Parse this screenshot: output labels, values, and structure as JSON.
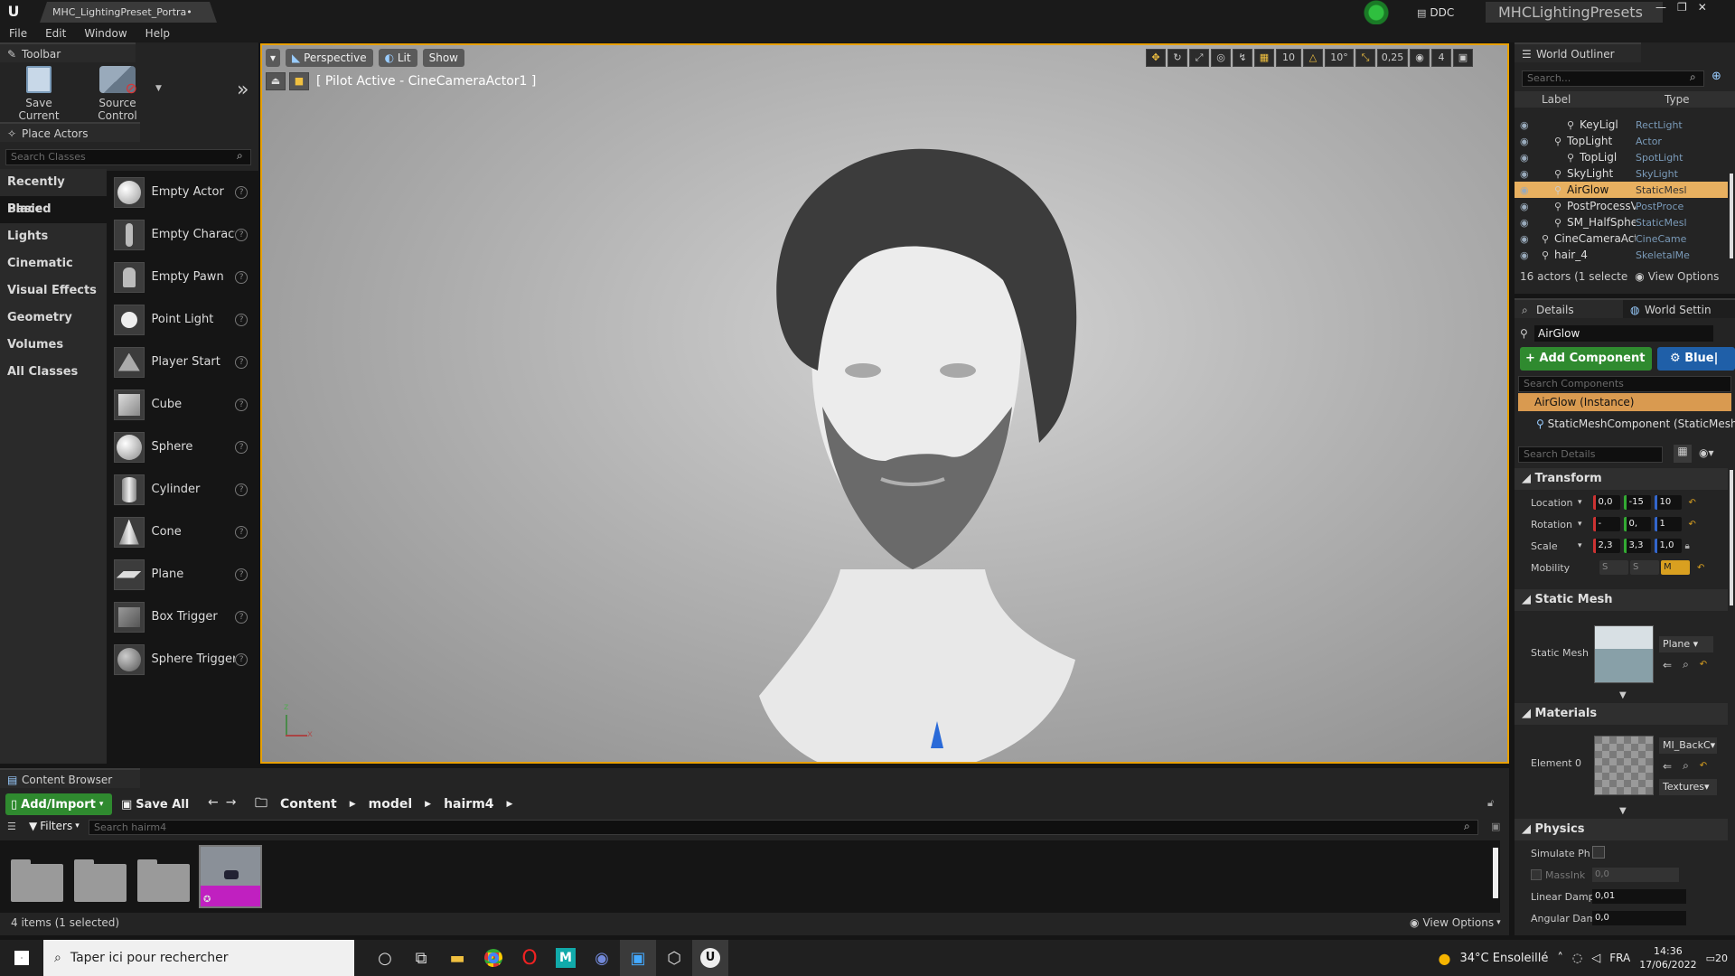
{
  "app": {
    "logo": "U",
    "doc_tab": "MHC_LightingPreset_Portra•",
    "ddc_label": "DDC",
    "project_name": "MHCLightingPresets",
    "menu": [
      "File",
      "Edit",
      "Window",
      "Help"
    ]
  },
  "toolbar": {
    "tab_label": "Toolbar",
    "save_current": "Save Current",
    "source_control": "Source Control"
  },
  "place_actors": {
    "tab_label": "Place Actors",
    "search_placeholder": "Search Classes",
    "categories": [
      "Recently Placed",
      "Basic",
      "Lights",
      "Cinematic",
      "Visual Effects",
      "Geometry",
      "Volumes",
      "All Classes"
    ],
    "selected_category": "Basic",
    "actors": [
      "Empty Actor",
      "Empty Charact",
      "Empty Pawn",
      "Point Light",
      "Player Start",
      "Cube",
      "Sphere",
      "Cylinder",
      "Cone",
      "Plane",
      "Box Trigger",
      "Sphere Trigger"
    ]
  },
  "viewport": {
    "perspective": "Perspective",
    "lit": "Lit",
    "show": "Show",
    "pilot_label": "[ Pilot Active - CineCameraActor1 ]",
    "grid_snap": "10",
    "rot_snap": "10°",
    "scale_snap": "0,25",
    "cam_speed": "4"
  },
  "outliner": {
    "tab_label": "World Outliner",
    "search_placeholder": "Search...",
    "col_label": "Label",
    "col_type": "Type",
    "rows": [
      {
        "label": "KeyLigl",
        "type": "RectLight",
        "indent": 2
      },
      {
        "label": "TopLight",
        "type": "Actor",
        "indent": 1
      },
      {
        "label": "TopLigl",
        "type": "SpotLight",
        "indent": 2
      },
      {
        "label": "SkyLight",
        "type": "SkyLight",
        "indent": 1
      },
      {
        "label": "AirGlow",
        "type": "StaticMesl",
        "indent": 1,
        "selected": true
      },
      {
        "label": "PostProcessV",
        "type": "PostProce",
        "indent": 1
      },
      {
        "label": "SM_HalfSpher",
        "type": "StaticMesl",
        "indent": 1
      },
      {
        "label": "CineCameraActc",
        "type": "CineCame",
        "indent": 0
      },
      {
        "label": "hair_4",
        "type": "SkeletalMe",
        "indent": 0
      }
    ],
    "footer": "16 actors (1 selecte",
    "view_options": "View Options"
  },
  "details": {
    "tab_label": "Details",
    "world_settings": "World Settin",
    "object_name": "AirGlow",
    "add_component": "+ Add Component",
    "blueprint": "Blue|",
    "search_components": "Search Components",
    "instance": "AirGlow (Instance)",
    "component": "StaticMeshComponent (StaticMeshC",
    "search_details": "Search Details",
    "transform_head": "Transform",
    "location_label": "Location",
    "location": [
      "0,0",
      "-15",
      "10"
    ],
    "rotation_label": "Rotation",
    "rotation": [
      "-",
      "0,",
      "1"
    ],
    "scale_label": "Scale",
    "scale": [
      "2,3",
      "3,3",
      "1,0"
    ],
    "mobility_label": "Mobility",
    "mobility": [
      "S",
      "S",
      "M"
    ],
    "static_mesh_head": "Static Mesh",
    "static_mesh_label": "Static Mesh",
    "static_mesh_value": "Plane",
    "materials_head": "Materials",
    "element_label": "Element 0",
    "material_value": "MI_BackC",
    "textures": "Textures",
    "physics_head": "Physics",
    "simulate": "Simulate Ph",
    "mass": "MassInk",
    "mass_value": "0,0",
    "linear_damp": "Linear Damp",
    "linear_damp_value": "0,01",
    "angular_damp": "Angular Dam",
    "angular_damp_value": "0,0"
  },
  "content_browser": {
    "tab_label": "Content Browser",
    "add_import": "Add/Import",
    "save_all": "Save All",
    "breadcrumb": [
      "Content",
      "model",
      "hairm4"
    ],
    "filters": "Filters",
    "search_placeholder": "Search hairm4",
    "status": "4 items (1 selected)",
    "view_options": "View Options"
  },
  "taskbar": {
    "search_placeholder": "Taper ici pour rechercher",
    "weather": "34°C  Ensoleillé",
    "lang": "FRA",
    "time": "14:36",
    "date": "17/06/2022",
    "notif": "20"
  },
  "colors": {
    "accent_orange": "#e8a000",
    "green": "#2f8a2f",
    "blue": "#1f5fa8",
    "selected_row": "#e8b060"
  }
}
